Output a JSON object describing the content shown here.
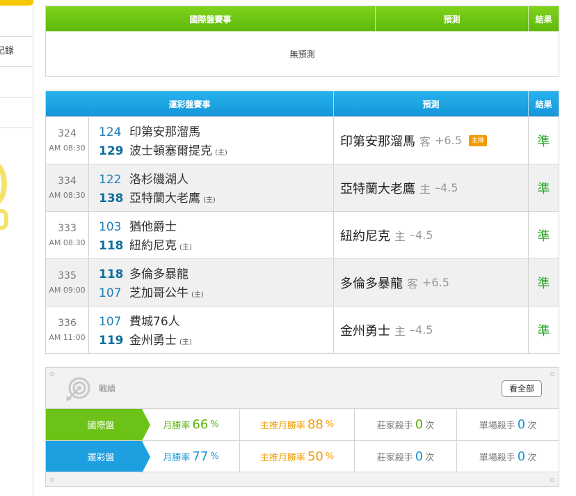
{
  "sidebar": {
    "item_record": "記錄"
  },
  "intl": {
    "headers": {
      "match": "國際盤賽事",
      "pred": "預測",
      "result": "結果"
    },
    "empty_text": "無預測"
  },
  "lottery": {
    "headers": {
      "match": "運彩盤賽事",
      "pred": "預測",
      "result": "結果"
    },
    "home_tag": "(主)",
    "rows": [
      {
        "id": "324",
        "time": "AM 08:30",
        "away_score": "124",
        "away": "印第安那溜馬",
        "home_score": "129",
        "home": "波士頓塞爾提克",
        "pred_team": "印第安那溜馬",
        "pred_side": "客",
        "pred_line": "+6.5",
        "badge": "主推",
        "result": "準",
        "winner": "home"
      },
      {
        "id": "334",
        "time": "AM 08:30",
        "away_score": "122",
        "away": "洛杉磯湖人",
        "home_score": "138",
        "home": "亞特蘭大老鷹",
        "pred_team": "亞特蘭大老鷹",
        "pred_side": "主",
        "pred_line": "–4.5",
        "badge": "",
        "result": "準",
        "winner": "home"
      },
      {
        "id": "333",
        "time": "AM 08:30",
        "away_score": "103",
        "away": "猶他爵士",
        "home_score": "118",
        "home": "紐約尼克",
        "pred_team": "紐約尼克",
        "pred_side": "主",
        "pred_line": "–4.5",
        "badge": "",
        "result": "準",
        "winner": "home"
      },
      {
        "id": "335",
        "time": "AM 09:00",
        "away_score": "118",
        "away": "多倫多暴龍",
        "home_score": "107",
        "home": "芝加哥公牛",
        "pred_team": "多倫多暴龍",
        "pred_side": "客",
        "pred_line": "+6.5",
        "badge": "",
        "result": "準",
        "winner": "away"
      },
      {
        "id": "336",
        "time": "AM 11:00",
        "away_score": "107",
        "away": "費城76人",
        "home_score": "119",
        "home": "金州勇士",
        "pred_team": "金州勇士",
        "pred_side": "主",
        "pred_line": "–4.5",
        "badge": "",
        "result": "準",
        "winner": "home"
      }
    ]
  },
  "record": {
    "title": "戰績",
    "view_all": "看全部",
    "rows": [
      {
        "label": "國際盤",
        "win_label": "月勝率",
        "win_value": "66",
        "top_label": "主推月勝率",
        "top_value": "88",
        "pct": "%",
        "banker_label": "莊家殺手",
        "banker_value": "0",
        "single_label": "單場殺手",
        "single_value": "0",
        "times": "次"
      },
      {
        "label": "運彩盤",
        "win_label": "月勝率",
        "win_value": "77",
        "top_label": "主推月勝率",
        "top_value": "50",
        "pct": "%",
        "banker_label": "莊家殺手",
        "banker_value": "0",
        "single_label": "單場殺手",
        "single_value": "0",
        "times": "次"
      }
    ]
  },
  "colors": {
    "green": "#6cc216",
    "blue": "#1d9fe0",
    "orange": "#f39a00",
    "result_green": "#2aa52a"
  }
}
